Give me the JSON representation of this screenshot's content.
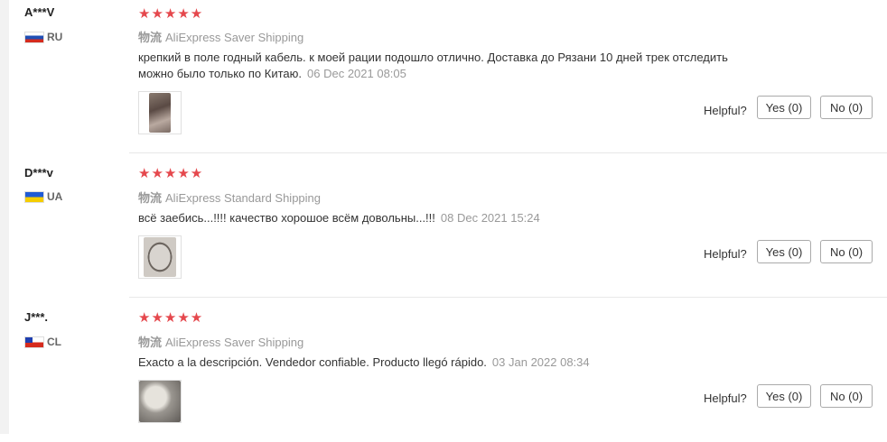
{
  "colors": {
    "star": "#e5484d",
    "muted": "#999999",
    "divider": "#e8e8e8"
  },
  "reviews": [
    {
      "user": "A***V",
      "country_code": "RU",
      "flag": "flag-ru",
      "rating": 5,
      "stars": "★★★★★",
      "shipping_label": "物流",
      "shipping_method": "AliExpress Saver Shipping",
      "text_line1": "крепкий в поле годный кабель. к моей рации подошло отлично. Доставка до Рязани 10 дней трек отследить",
      "text_line2": "можно было только по Китаю.",
      "date": "06 Dec 2021 08:05",
      "helpful_label": "Helpful?",
      "yes_label": "Yes (0)",
      "no_label": "No (0)"
    },
    {
      "user": "D***v",
      "country_code": "UA",
      "flag": "flag-ua",
      "rating": 5,
      "stars": "★★★★★",
      "shipping_label": "物流",
      "shipping_method": "AliExpress Standard Shipping",
      "text_line1": "всё заебись...!!!! качество хорошое всём довольны...!!!",
      "date": "08 Dec 2021 15:24",
      "helpful_label": "Helpful?",
      "yes_label": "Yes (0)",
      "no_label": "No (0)"
    },
    {
      "user": "J***.",
      "country_code": "CL",
      "flag": "flag-cl",
      "rating": 5,
      "stars": "★★★★★",
      "shipping_label": "物流",
      "shipping_method": "AliExpress Saver Shipping",
      "text_line1": "Exacto a la descripción. Vendedor confiable. Producto llegó rápido.",
      "date": "03 Jan 2022 08:34",
      "helpful_label": "Helpful?",
      "yes_label": "Yes (0)",
      "no_label": "No (0)"
    }
  ]
}
